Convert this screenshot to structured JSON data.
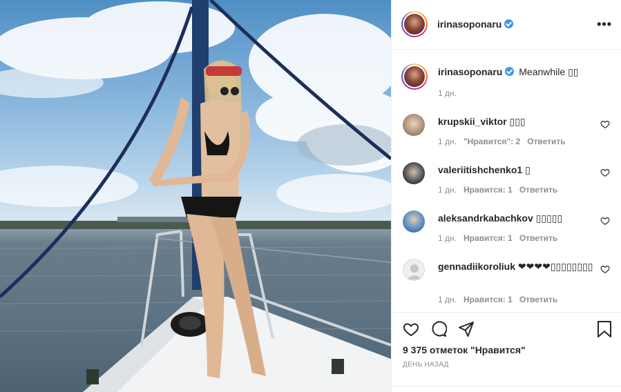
{
  "post": {
    "author": "irinasoponaru",
    "caption_author": "irinasoponaru",
    "caption_text": "Meanwhile ▯▯",
    "caption_time": "1 дн.",
    "more_label": "•••"
  },
  "comments": [
    {
      "user": "krupskii_viktor",
      "text": "▯▯▯",
      "time": "1 дн.",
      "likes": "\"Нравится\": 2",
      "reply": "Ответить"
    },
    {
      "user": "valeriitishchenko1",
      "text": "▯",
      "time": "1 дн.",
      "likes": "Нравится: 1",
      "reply": "Ответить"
    },
    {
      "user": "aleksandrkabachkov",
      "text": "▯▯▯▯▯",
      "time": "1 дн.",
      "likes": "Нравится: 1",
      "reply": "Ответить"
    },
    {
      "user": "gennadiikoroliuk",
      "text": "❤❤❤❤▯▯▯▯▯▯▯▯",
      "time": "1 дн.",
      "likes": "Нравится: 1",
      "reply": "Ответить"
    }
  ],
  "actions": {
    "likes_count": "9 375 отметок \"Нравится\"",
    "time_ago": "день назад",
    "icons": [
      "heart-icon",
      "comment-icon",
      "share-icon",
      "bookmark-icon"
    ]
  },
  "colors": {
    "verified": "#3897f0",
    "meta_gray": "#8e8e8e",
    "text": "#262626"
  }
}
